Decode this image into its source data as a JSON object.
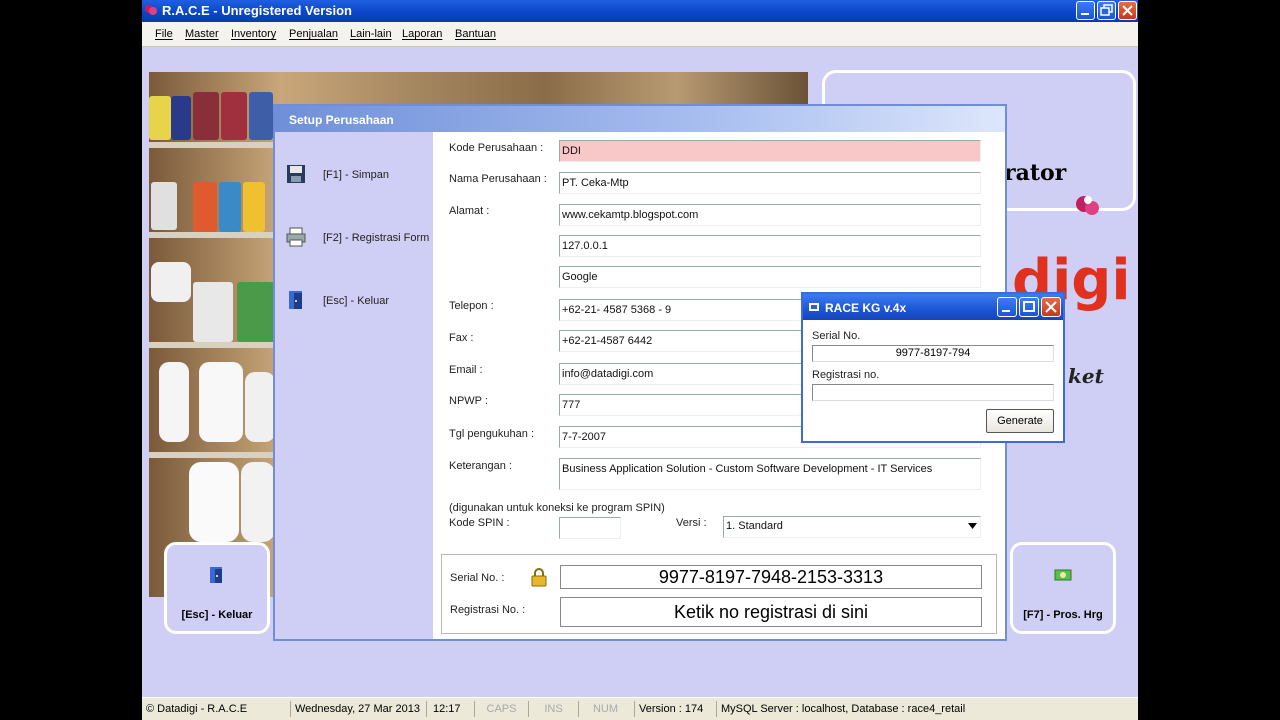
{
  "window": {
    "title": "R.A.C.E - Unregistered Version"
  },
  "menu": [
    "File",
    "Master",
    "Inventory",
    "Penjualan",
    "Lain-lain",
    "Laporan",
    "Bantuan"
  ],
  "background": {
    "logo_partial_1": "rator",
    "logo_partial_2": "digi",
    "logo_partial_3": "ket",
    "esc_button": "[Esc] - Keluar",
    "f7_button": "[F7] - Pros. Hrg"
  },
  "setup": {
    "title": "Setup Perusahaan",
    "actions": [
      {
        "label": "[F1] - Simpan",
        "icon": "save-icon"
      },
      {
        "label": "[F2] - Registrasi Form",
        "icon": "printer-icon"
      },
      {
        "label": "[Esc] - Keluar",
        "icon": "exit-door-icon"
      }
    ],
    "labels": {
      "kode": "Kode Perusahaan :",
      "nama": "Nama Perusahaan :",
      "alamat": "Alamat :",
      "telepon": "Telepon :",
      "fax": "Fax :",
      "email": "Email :",
      "npwp": "NPWP :",
      "tgl": "Tgl pengukuhan :",
      "keterangan": "Keterangan :",
      "spin_note": "(digunakan untuk koneksi ke program SPIN)",
      "kode_spin": "Kode SPIN :",
      "versi": "Versi :",
      "serial": "Serial No. :",
      "registrasi": "Registrasi No. :"
    },
    "values": {
      "kode": "DDI",
      "nama": "PT. Ceka-Mtp",
      "alamat1": "www.cekamtp.blogspot.com",
      "alamat2": "127.0.0.1",
      "alamat3": "Google",
      "telepon": "+62-21- 4587 5368 - 9",
      "fax": "+62-21-4587 6442",
      "email": "info@datadigi.com",
      "npwp": "777",
      "tgl": "7-7-2007",
      "keterangan": "Business Application Solution - Custom Software Development - IT Services",
      "kode_spin": "",
      "versi": "1. Standard",
      "serial": "9977-8197-7948-2153-3313",
      "registrasi": "Ketik no registrasi di sini"
    }
  },
  "kg_dialog": {
    "title": "RACE KG v.4x",
    "serial_label": "Serial No.",
    "serial_value": "9977-8197-794",
    "reg_label": "Registrasi no.",
    "reg_value": "",
    "generate": "Generate"
  },
  "status": {
    "copyright": "© Datadigi - R.A.C.E",
    "date": "Wednesday, 27 Mar 2013",
    "time": "12:17",
    "caps": "CAPS",
    "ins": "INS",
    "num": "NUM",
    "version": "Version : 174",
    "server": "MySQL Server : localhost, Database : race4_retail"
  },
  "colors": {
    "accent": "#0a44c8",
    "background": "#cfcff5",
    "pink_field": "#f8c8c8",
    "logo_red": "#e0301e"
  }
}
